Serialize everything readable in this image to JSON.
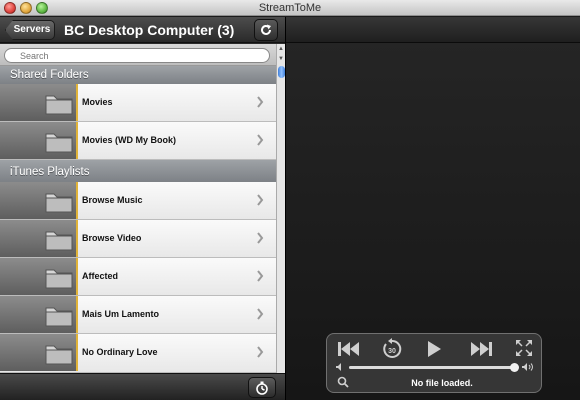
{
  "window": {
    "title": "StreamToMe"
  },
  "navbar": {
    "back_label": "Servers",
    "title": "BC Desktop Computer (3)"
  },
  "search": {
    "placeholder": "Search"
  },
  "sections": [
    {
      "title": "Shared Folders",
      "items": [
        {
          "label": "Movies"
        },
        {
          "label": "Movies (WD My Book)"
        }
      ]
    },
    {
      "title": "iTunes Playlists",
      "items": [
        {
          "label": "Browse Music"
        },
        {
          "label": "Browse Video"
        },
        {
          "label": "Affected"
        },
        {
          "label": "Mais Um Lamento"
        },
        {
          "label": "No Ordinary Love"
        }
      ]
    }
  ],
  "player": {
    "status": "No file loaded.",
    "skip_seconds": "30",
    "progress_fraction": 0.98
  },
  "colors": {
    "accent_stripe": "#e0b339",
    "scroll_blue": "#3e7ed8"
  }
}
